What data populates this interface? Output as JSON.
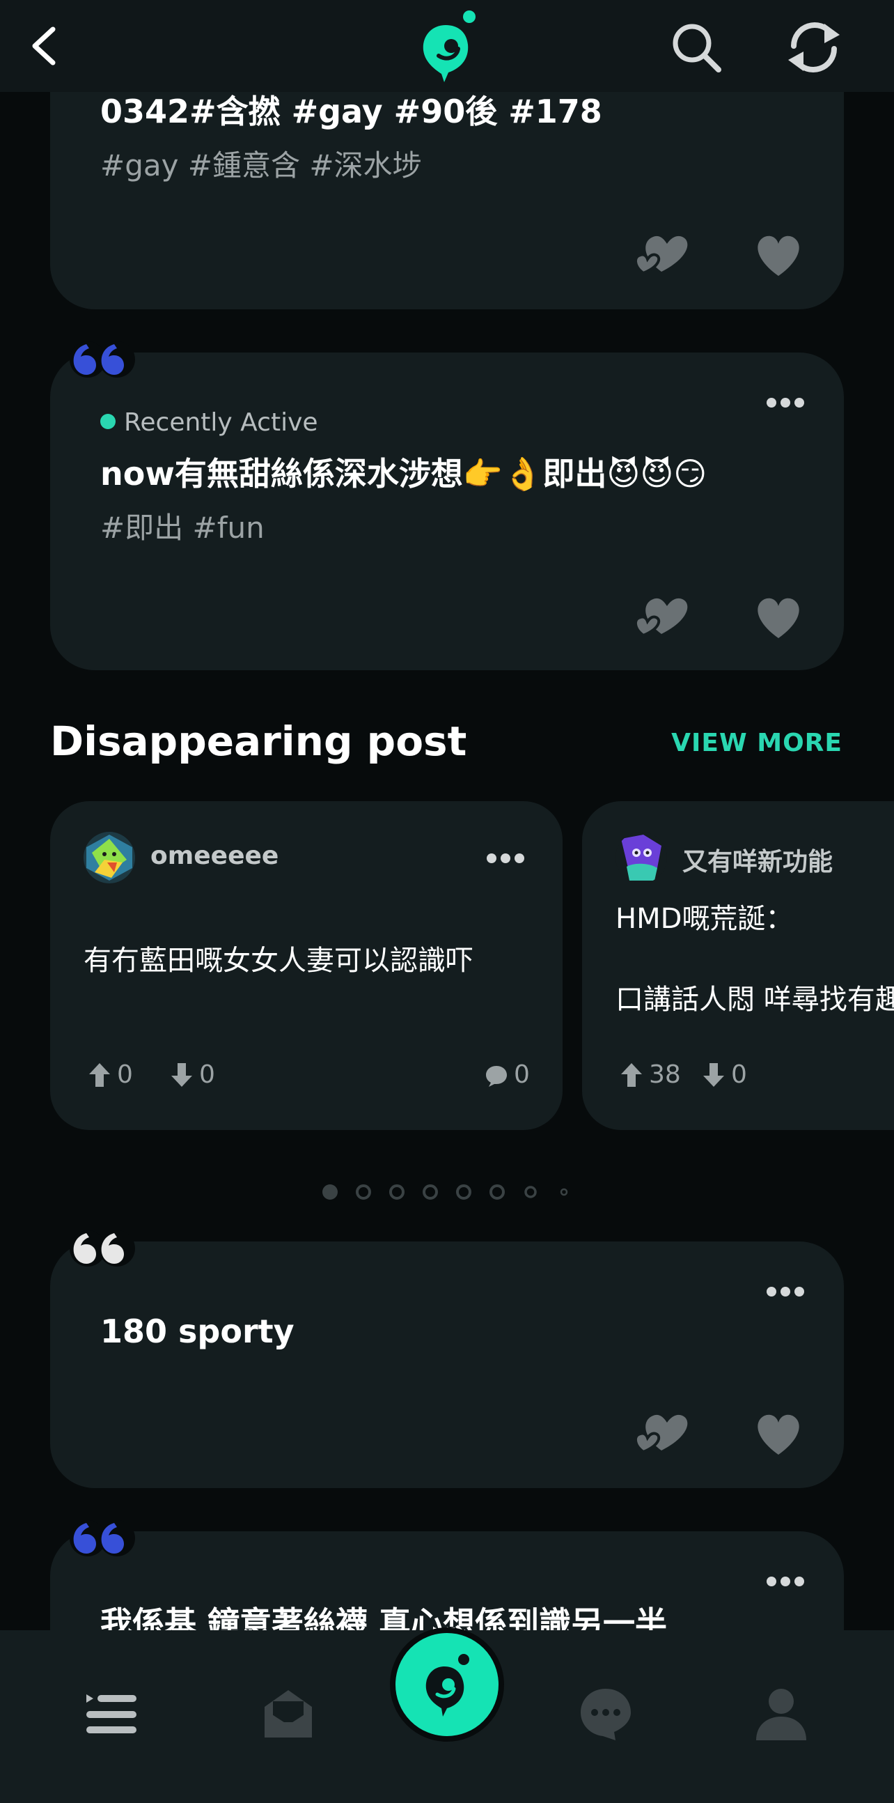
{
  "colors": {
    "accent": "#2ad7b1",
    "card": "#141d1f",
    "background": "#070b0c",
    "quote_blue": "#3750d8",
    "quote_white": "#e7e7e7"
  },
  "topbar": {
    "icons": [
      "back-arrow-icon",
      "app-logo-icon",
      "search-icon",
      "refresh-icon"
    ]
  },
  "feed": [
    {
      "title": "0342#含撚 #gay #90後 #178",
      "tags": "#gay #鍾意含 #深水埗"
    },
    {
      "status": "Recently Active",
      "title": "now有無甜絲係深水涉想👉👌即出😈😈😏",
      "tags": "#即出 #fun"
    },
    {
      "title": "180 sporty"
    },
    {
      "title": "我係基 鐘意著絲襪 真心想係到識另一半"
    }
  ],
  "disappearing": {
    "title": "Disappearing post",
    "view_more": "VIEW MORE",
    "posts": [
      {
        "username": "omeeeee",
        "text": "有冇藍田嘅女女人妻可以認識吓",
        "upvotes": "0",
        "downvotes": "0",
        "comments": "0"
      },
      {
        "username": "又有咩新功能",
        "text_line1": "HMD嘅荒誕：",
        "text_line2": "口講話人悶 咩尋找有趣",
        "upvotes": "38",
        "downvotes": "0"
      }
    ],
    "pager": {
      "pages": 8,
      "current": 1
    }
  },
  "bottomnav": {
    "items": [
      "feed-icon",
      "inbox-icon",
      "compose-icon",
      "chat-icon",
      "profile-icon"
    ]
  }
}
